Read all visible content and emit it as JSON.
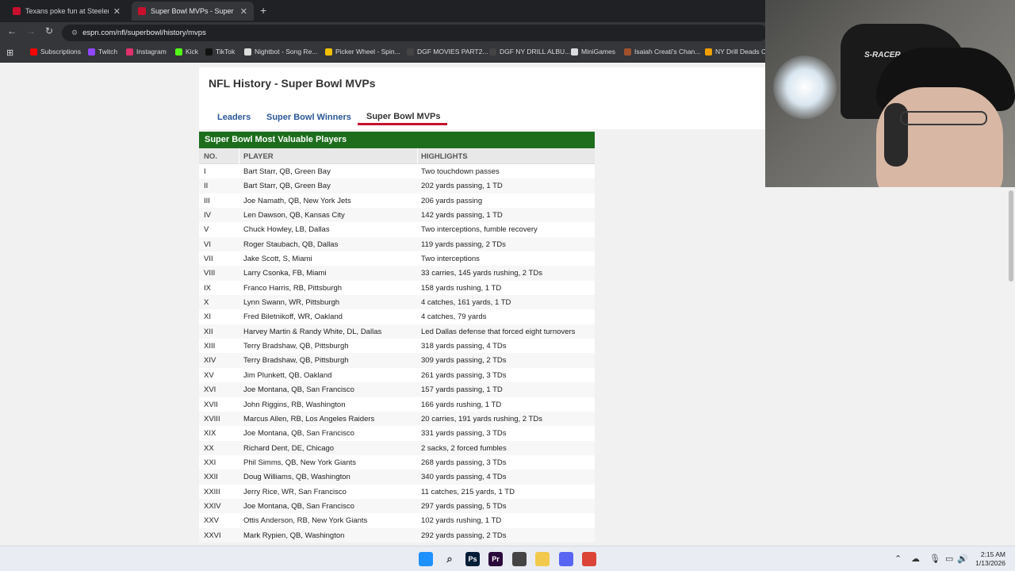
{
  "browser": {
    "tabs": [
      {
        "label": "Texans poke fun at Steelers afte",
        "active": false
      },
      {
        "label": "Super Bowl MVPs - Super Bowl",
        "active": true
      }
    ],
    "url": "espn.com/nfl/superbowl/history/mvps",
    "bookmarks": [
      {
        "label": "Subscriptions",
        "icon": "youtube-icon",
        "color": "#ff0000"
      },
      {
        "label": "Twitch",
        "icon": "twitch-icon",
        "color": "#9146ff"
      },
      {
        "label": "Instagram",
        "icon": "instagram-icon",
        "color": "#e1306c"
      },
      {
        "label": "Kick",
        "icon": "kick-icon",
        "color": "#53fc18"
      },
      {
        "label": "TikTok",
        "icon": "tiktok-icon",
        "color": "#111111"
      },
      {
        "label": "Nightbot - Song Re...",
        "icon": "nightbot-icon",
        "color": "#dddddd"
      },
      {
        "label": "Picker Wheel - Spin...",
        "icon": "wheel-icon",
        "color": "#f2c200"
      },
      {
        "label": "DGF MOVIES PART2...",
        "icon": "page-icon",
        "color": "#444444"
      },
      {
        "label": "DGF NY DRILL ALBU...",
        "icon": "page-icon",
        "color": "#444444"
      },
      {
        "label": "MiniGames",
        "icon": "folder-icon",
        "color": "#dadce0"
      },
      {
        "label": "Isaiah Creati's Chan...",
        "icon": "page-icon",
        "color": "#a0522d"
      },
      {
        "label": "NY Drill Deads Ou",
        "icon": "page-icon",
        "color": "#f2a000"
      }
    ]
  },
  "page": {
    "title": "NFL History - Super Bowl MVPs",
    "nav_tabs": [
      {
        "label": "Leaders",
        "active": false
      },
      {
        "label": "Super Bowl Winners",
        "active": false
      },
      {
        "label": "Super Bowl MVPs",
        "active": true
      }
    ],
    "table": {
      "heading": "Super Bowl Most Valuable Players",
      "columns": [
        "NO.",
        "PLAYER",
        "HIGHLIGHTS"
      ],
      "rows": [
        [
          "I",
          "Bart Starr, QB, Green Bay",
          "Two touchdown passes"
        ],
        [
          "II",
          "Bart Starr, QB, Green Bay",
          "202 yards passing, 1 TD"
        ],
        [
          "III",
          "Joe Namath, QB, New York Jets",
          "206 yards passing"
        ],
        [
          "IV",
          "Len Dawson, QB, Kansas City",
          "142 yards passing, 1 TD"
        ],
        [
          "V",
          "Chuck Howley, LB, Dallas",
          "Two interceptions, fumble recovery"
        ],
        [
          "VI",
          "Roger Staubach, QB, Dallas",
          "119 yards passing, 2 TDs"
        ],
        [
          "VII",
          "Jake Scott, S, Miami",
          "Two interceptions"
        ],
        [
          "VIII",
          "Larry Csonka, FB, Miami",
          "33 carries, 145 yards rushing, 2 TDs"
        ],
        [
          "IX",
          "Franco Harris, RB, Pittsburgh",
          "158 yards rushing, 1 TD"
        ],
        [
          "X",
          "Lynn Swann, WR, Pittsburgh",
          "4 catches, 161 yards, 1 TD"
        ],
        [
          "XI",
          "Fred Biletnikoff, WR, Oakland",
          "4 catches, 79 yards"
        ],
        [
          "XII",
          "Harvey Martin & Randy White, DL, Dallas",
          "Led Dallas defense that forced eight turnovers"
        ],
        [
          "XIII",
          "Terry Bradshaw, QB, Pittsburgh",
          "318 yards passing, 4 TDs"
        ],
        [
          "XIV",
          "Terry Bradshaw, QB, Pittsburgh",
          "309 yards passing, 2 TDs"
        ],
        [
          "XV",
          "Jim Plunkett, QB, Oakland",
          "261 yards passing, 3 TDs"
        ],
        [
          "XVI",
          "Joe Montana, QB, San Francisco",
          "157 yards passing, 1 TD"
        ],
        [
          "XVII",
          "John Riggins, RB, Washington",
          "166 yards rushing, 1 TD"
        ],
        [
          "XVIII",
          "Marcus Allen, RB, Los Angeles Raiders",
          "20 carries, 191 yards rushing, 2 TDs"
        ],
        [
          "XIX",
          "Joe Montana, QB, San Francisco",
          "331 yards passing, 3 TDs"
        ],
        [
          "XX",
          "Richard Dent, DE, Chicago",
          "2 sacks, 2 forced fumbles"
        ],
        [
          "XXI",
          "Phil Simms, QB, New York Giants",
          "268 yards passing, 3 TDs"
        ],
        [
          "XXII",
          "Doug Williams, QB, Washington",
          "340 yards passing, 4 TDs"
        ],
        [
          "XXIII",
          "Jerry Rice, WR, San Francisco",
          "11 catches, 215 yards, 1 TD"
        ],
        [
          "XXIV",
          "Joe Montana, QB, San Francisco",
          "297 yards passing, 5 TDs"
        ],
        [
          "XXV",
          "Ottis Anderson, RB, New York Giants",
          "102 yards rushing, 1 TD"
        ],
        [
          "XXVI",
          "Mark Rypien, QB, Washington",
          "292 yards passing, 2 TDs"
        ]
      ]
    }
  },
  "webcam": {
    "chair_brand": "S-RACER"
  },
  "taskbar": {
    "apps": [
      {
        "icon": "windows-start-icon",
        "color": "#1e90ff",
        "text": ""
      },
      {
        "icon": "search-icon",
        "color": "#e9ecf3",
        "text": ""
      },
      {
        "icon": "photoshop-icon",
        "color": "#001e36",
        "text": "Ps"
      },
      {
        "icon": "premiere-icon",
        "color": "#2a0a3a",
        "text": "Pr"
      },
      {
        "icon": "obs-icon",
        "color": "#444444",
        "text": ""
      },
      {
        "icon": "file-explorer-icon",
        "color": "#f2c94c",
        "text": ""
      },
      {
        "icon": "discord-icon",
        "color": "#5865f2",
        "text": ""
      },
      {
        "icon": "chrome-icon",
        "color": "#db4437",
        "text": ""
      }
    ],
    "time": "2:15 AM",
    "date": "1/13/2026"
  },
  "colors": {
    "table_header": "#1d6d1d",
    "accent_red": "#c8102e",
    "link_blue": "#2b5797"
  }
}
